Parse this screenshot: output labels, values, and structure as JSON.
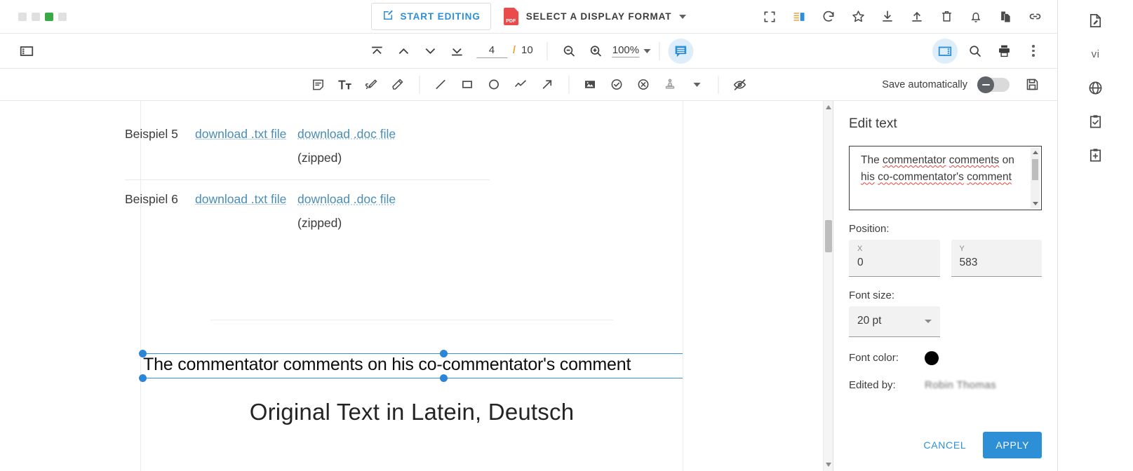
{
  "window": {
    "dots": [
      "inactive",
      "inactive",
      "active",
      "inactive"
    ]
  },
  "topbar": {
    "start_editing_label": "START EDITING",
    "edit_icon": "pencil-square-icon",
    "format_select_label": "SELECT A DISPLAY FORMAT",
    "format_badge_text": "PDF",
    "icons": [
      {
        "name": "fullscreen-icon",
        "title": "Fullscreen"
      },
      {
        "name": "layout-panel-icon",
        "title": "Layout"
      },
      {
        "name": "rotate-icon",
        "title": "Rotate"
      },
      {
        "name": "star-icon",
        "title": "Favorite"
      },
      {
        "name": "download-icon",
        "title": "Download"
      },
      {
        "name": "upload-icon",
        "title": "Upload"
      },
      {
        "name": "trash-icon",
        "title": "Delete"
      },
      {
        "name": "bell-icon",
        "title": "Notifications"
      },
      {
        "name": "copy-icon",
        "title": "Copy"
      },
      {
        "name": "link-icon",
        "title": "Share link"
      }
    ]
  },
  "navbar": {
    "sidebar_toggle_icon": "sidebar-toggle-icon",
    "first_page_icon": "first-page-icon",
    "prev_page_icon": "chevron-up-icon",
    "next_page_icon": "chevron-down-icon",
    "last_page_icon": "last-page-icon",
    "current_page": "4",
    "page_separator": "/",
    "total_pages": "10",
    "zoom_out_icon": "zoom-out-icon",
    "zoom_in_icon": "zoom-in-icon",
    "zoom_level": "100%",
    "comment_icon": "comment-panel-icon",
    "thumbnails_icon": "thumbnails-panel-icon",
    "search_icon": "search-icon",
    "print_icon": "print-icon",
    "more_icon": "more-vertical-icon"
  },
  "toolbar": {
    "tools": [
      {
        "name": "sticky-note-icon",
        "title": "Note"
      },
      {
        "name": "text-tool-icon",
        "title": "Text"
      },
      {
        "name": "freehand-icon",
        "title": "Freehand"
      },
      {
        "name": "highlighter-icon",
        "title": "Highlight"
      },
      {
        "name": "line-icon",
        "title": "Line"
      },
      {
        "name": "rectangle-icon",
        "title": "Rectangle"
      },
      {
        "name": "ellipse-icon",
        "title": "Ellipse"
      },
      {
        "name": "polyline-icon",
        "title": "Polyline"
      },
      {
        "name": "arrow-icon",
        "title": "Arrow"
      },
      {
        "name": "image-icon",
        "title": "Image"
      },
      {
        "name": "checkmark-icon",
        "title": "Checkmark"
      },
      {
        "name": "cross-icon",
        "title": "Cross"
      },
      {
        "name": "stamp-icon",
        "title": "Stamp"
      }
    ],
    "stamp_caret_icon": "chevron-down-icon",
    "hide_annotations_icon": "eye-off-icon",
    "save_automatically_label": "Save automatically",
    "save_automatically_on": false,
    "save_icon": "save-icon"
  },
  "document": {
    "rows": [
      {
        "label": "Beispiel 5",
        "txt_link": "download .txt file",
        "doc_link": "download .doc file",
        "doc_note": "(zipped)"
      },
      {
        "label": "Beispiel 6",
        "txt_link": "download .txt file",
        "doc_link": "download .doc file",
        "doc_note": "(zipped)"
      }
    ],
    "annotation_text": "The commentator comments on his co-commentator's comment",
    "heading": "Original Text in Latein, Deutsch"
  },
  "panel": {
    "title": "Edit text",
    "textarea_value": "The commentator comments on his co-commentator's comment",
    "textarea_words": [
      {
        "t": "The ",
        "sq": false
      },
      {
        "t": "commentator",
        "sq": true
      },
      {
        "t": " ",
        "sq": false
      },
      {
        "t": "comments",
        "sq": true
      },
      {
        "t": " on ",
        "sq": false
      },
      {
        "t": "his",
        "sq": true
      },
      {
        "t": " ",
        "sq": false
      },
      {
        "t": "co-commentator's",
        "sq": true
      },
      {
        "t": " ",
        "sq": false
      },
      {
        "t": "comment",
        "sq": true
      }
    ],
    "position_label": "Position:",
    "x_label": "X",
    "x_value": "0",
    "y_label": "Y",
    "y_value": "583",
    "font_size_label": "Font size:",
    "font_size_value": "20 pt",
    "font_color_label": "Font color:",
    "font_color_value": "#000000",
    "edited_by_label": "Edited by:",
    "edited_by_value": "Robin Thomas",
    "cancel_label": "CANCEL",
    "apply_label": "APPLY"
  },
  "rail": {
    "items": [
      {
        "name": "document-edit-icon",
        "label": ""
      },
      {
        "name": "vi-badge",
        "label": "vi"
      },
      {
        "name": "globe-icon",
        "label": ""
      },
      {
        "name": "clipboard-check-icon",
        "label": ""
      },
      {
        "name": "clipboard-add-icon",
        "label": ""
      }
    ]
  },
  "colors": {
    "accent": "#2d8fd5",
    "accent_light": "#ddeefa",
    "pdf_red": "#ea4b4b",
    "green": "#39a845",
    "orange": "#e8a33d",
    "icon_gray": "#5f6368"
  }
}
